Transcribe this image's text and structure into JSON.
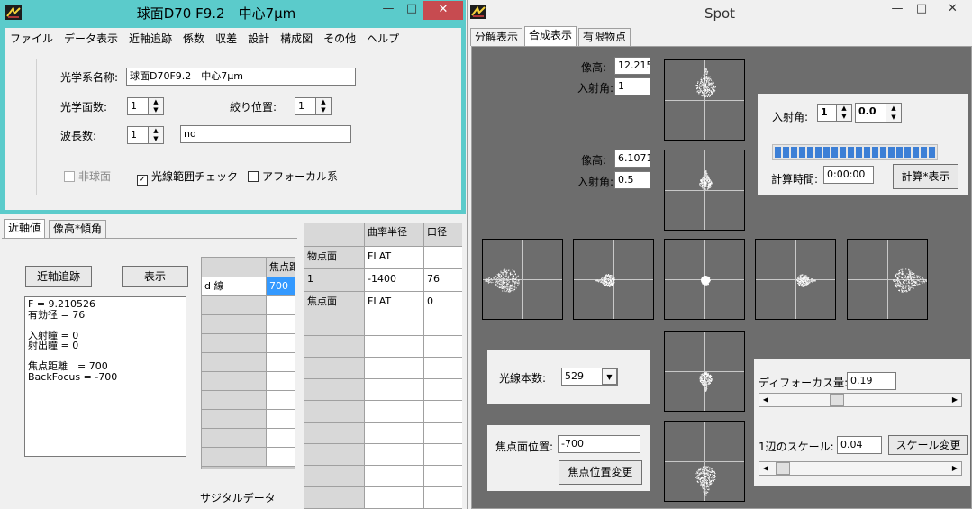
{
  "left_window": {
    "title": "球面D70 F9.2　中心7μm",
    "controls": {
      "min": "—",
      "max": "□",
      "close": "✕"
    },
    "menu": [
      "ファイル",
      "データ表示",
      "近軸追跡",
      "係数",
      "収差",
      "設計",
      "構成図",
      "その他",
      "ヘルプ"
    ],
    "form": {
      "system_name_label": "光学系名称:",
      "system_name_value": "球面D70F9.2　中心7μm",
      "surfaces_label": "光学面数:",
      "surfaces_value": "1",
      "stop_label": "絞り位置:",
      "stop_value": "1",
      "wavelengths_label": "波長数:",
      "wavelengths_value": "1",
      "wavelength_name": "nd",
      "aspheric_label": "非球面",
      "ray_check_label": "光線範囲チェック",
      "afocal_label": "アフォーカル系"
    }
  },
  "paraxial_panel": {
    "tabs": [
      "近軸値",
      "像高*傾角"
    ],
    "trace_button": "近軸追跡",
    "show_button": "表示",
    "output_lines": [
      "F = 9.210526",
      "有効径 = 76",
      "",
      "入射瞳 = 0",
      "射出瞳 = 0",
      "",
      "焦点距離　= 700",
      "BackFocus = -700"
    ],
    "wave_table": {
      "header": "焦点距",
      "row_label": "d 線",
      "row_value": "700"
    },
    "sagittal_label": "サジタルデータ"
  },
  "surface_table": {
    "headers": [
      "",
      "曲率半径",
      "口径"
    ],
    "rows": [
      [
        "物点面",
        "FLAT",
        ""
      ],
      [
        "1",
        "-1400",
        "76"
      ],
      [
        "焦点面",
        "FLAT",
        "0"
      ]
    ]
  },
  "spot_window": {
    "title": "Spot",
    "controls": {
      "min": "—",
      "max": "□",
      "close": "✕"
    },
    "tabs": [
      "分解表示",
      "合成表示",
      "有限物点"
    ],
    "image_height_label": "像高:",
    "incidence_label": "入射角:",
    "top_image_height": "12.215",
    "top_incidence": "1",
    "mid_image_height": "6.1071",
    "mid_incidence": "0.5",
    "calc": {
      "incidence_label": "入射角:",
      "incidence_int": "1",
      "incidence_frac": "0.0",
      "progress": 1.0,
      "time_label": "計算時間:",
      "time_value": "0:00:00",
      "calc_button": "計算*表示"
    },
    "rays": {
      "label": "光線本数:",
      "value": "529"
    },
    "focal": {
      "label": "焦点面位置:",
      "value": "-700",
      "button": "焦点位置変更"
    },
    "defocus": {
      "label": "ディフォーカス量:",
      "value": "0.19",
      "slider": 0.35
    },
    "scale": {
      "label": "1辺のスケール:",
      "value": "0.04",
      "button": "スケール変更",
      "slider": 0.02
    }
  },
  "colors": {
    "accent_title": "#5bcbcb",
    "close_red": "#c74b50",
    "progress": "#3c7fd6",
    "spot_bg": "#6d6d6d"
  }
}
